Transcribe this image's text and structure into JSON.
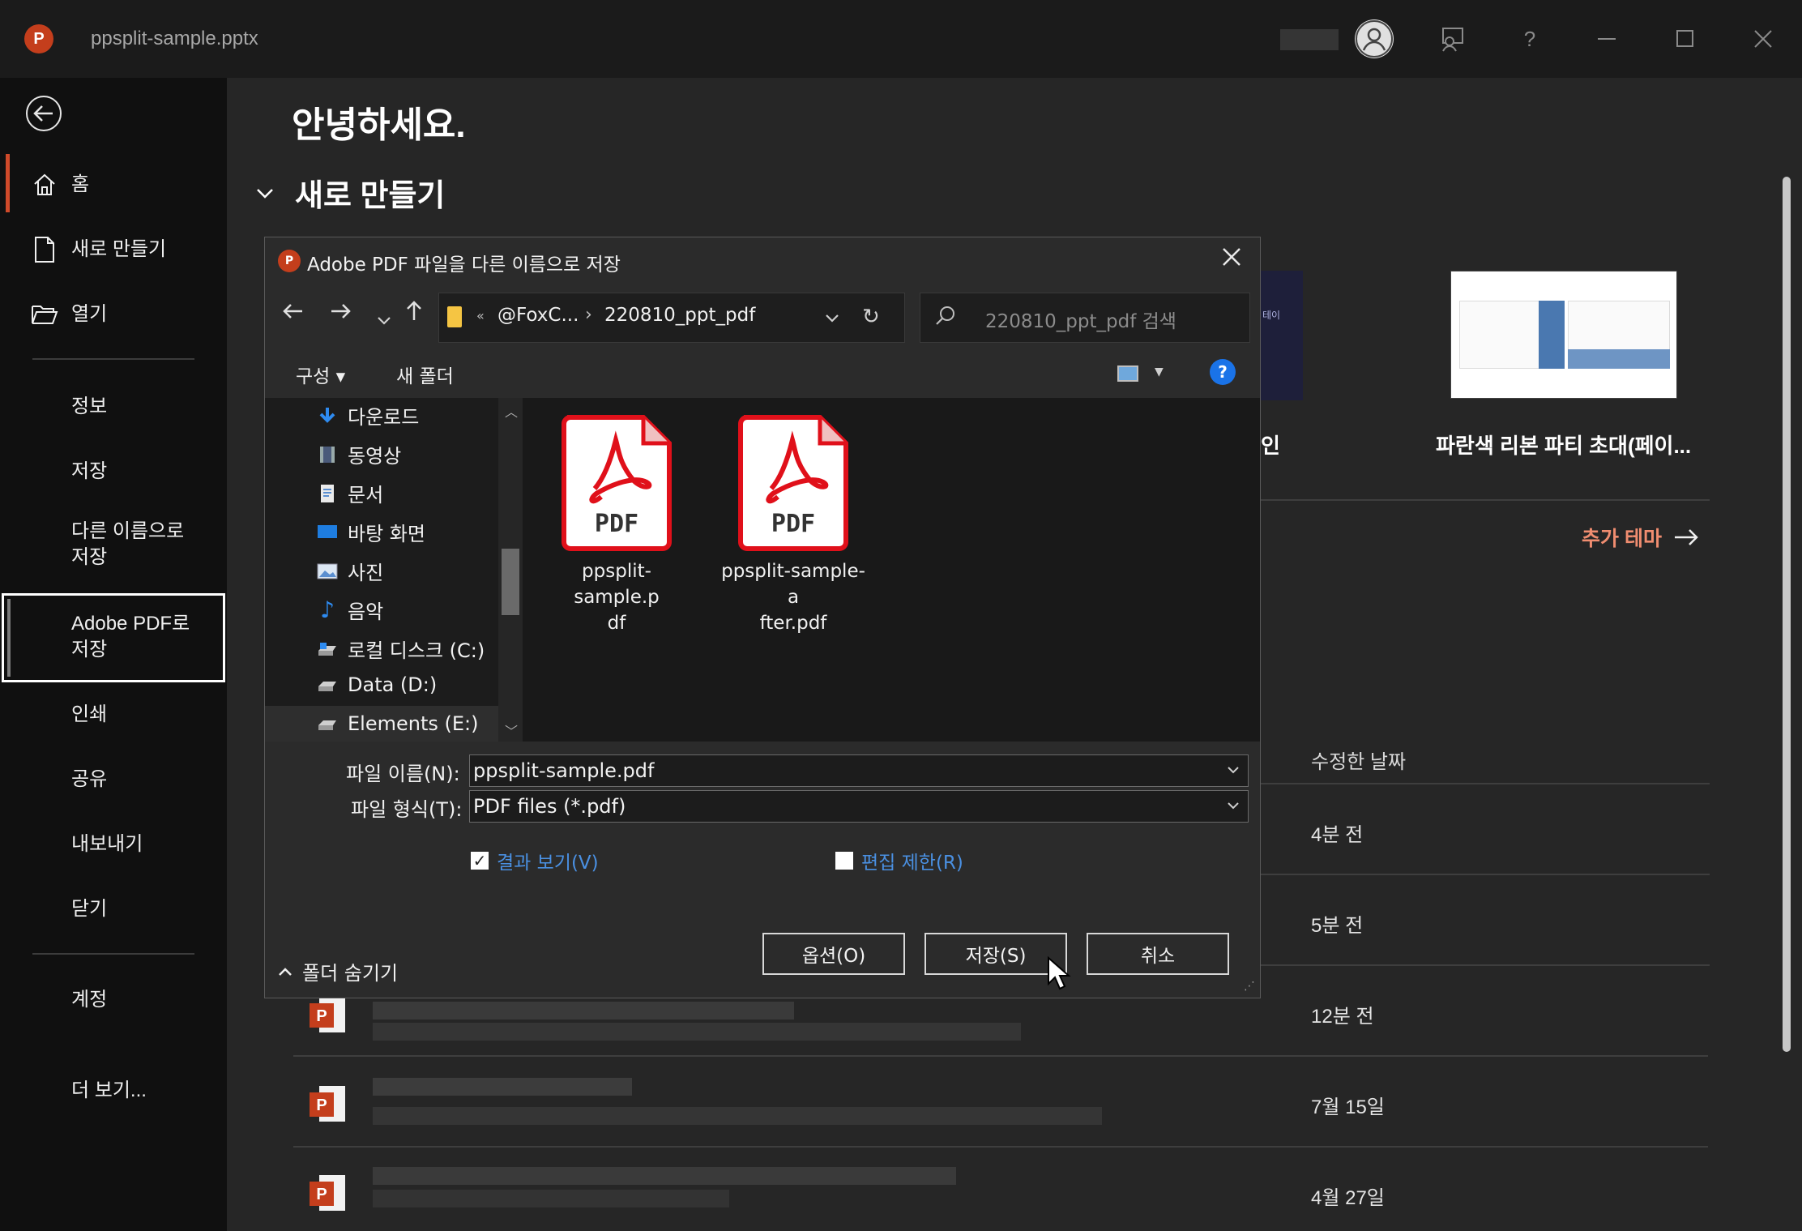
{
  "titlebar": {
    "app_badge": "P",
    "document": "ppsplit-sample.pptx"
  },
  "sidebar": {
    "items": [
      {
        "label": "홈"
      },
      {
        "label": "새로 만들기"
      },
      {
        "label": "열기"
      },
      {
        "label": "정보"
      },
      {
        "label": "저장"
      },
      {
        "label": "다른 이름으로\n저장"
      },
      {
        "label": "Adobe PDF로\n저장"
      },
      {
        "label": "인쇄"
      },
      {
        "label": "공유"
      },
      {
        "label": "내보내기"
      },
      {
        "label": "닫기"
      },
      {
        "label": "계정"
      },
      {
        "label": "더 보기..."
      }
    ]
  },
  "main": {
    "greeting": "안녕하세요.",
    "new_section": "새로 만들기",
    "template_dark_snippet": "테이",
    "template_dark_tail": "인",
    "template_light_name": "파란색 리본 파티 초대(페이...",
    "more_themes": "추가 테마",
    "column_modified": "수정한 날짜",
    "recent_dates": [
      "4분 전",
      "5분 전",
      "12분 전",
      "7월 15일",
      "4월 27일"
    ]
  },
  "dialog": {
    "title": "Adobe PDF 파일을 다른 이름으로 저장",
    "app_badge": "P",
    "path": {
      "root": "@FoxC...",
      "folder": "220810_ppt_pdf",
      "overflow": "«"
    },
    "search_placeholder": "220810_ppt_pdf 검색",
    "toolbar": {
      "organize": "구성 ▾",
      "new_folder": "새 폴더",
      "help": "?"
    },
    "tree": [
      {
        "label": "다운로드"
      },
      {
        "label": "동영상"
      },
      {
        "label": "문서"
      },
      {
        "label": "바탕 화면"
      },
      {
        "label": "사진"
      },
      {
        "label": "음악"
      },
      {
        "label": "로컬 디스크 (C:)"
      },
      {
        "label": "Data (D:)"
      },
      {
        "label": "Elements (E:)"
      }
    ],
    "files": [
      {
        "name_l1": "ppsplit-sample.p",
        "name_l2": "df",
        "badge": "PDF"
      },
      {
        "name_l1": "ppsplit-sample-a",
        "name_l2": "fter.pdf",
        "badge": "PDF"
      }
    ],
    "filename_label": "파일 이름(N):",
    "filename_value": "ppsplit-sample.pdf",
    "filetype_label": "파일 형식(T):",
    "filetype_value": "PDF files (*.pdf)",
    "view_result_label": "결과 보기(V)",
    "view_result_checked": true,
    "restrict_edit_label": "편집 제한(R)",
    "restrict_edit_checked": false,
    "hide_folders": "폴더 숨기기",
    "options_button": "옵션(O)",
    "save_button": "저장(S)",
    "cancel_button": "취소"
  },
  "colors": {
    "accent": "#d04a2a",
    "link": "#4a90e2",
    "pdf_red": "#e0101a",
    "themes": "#f08d70"
  }
}
